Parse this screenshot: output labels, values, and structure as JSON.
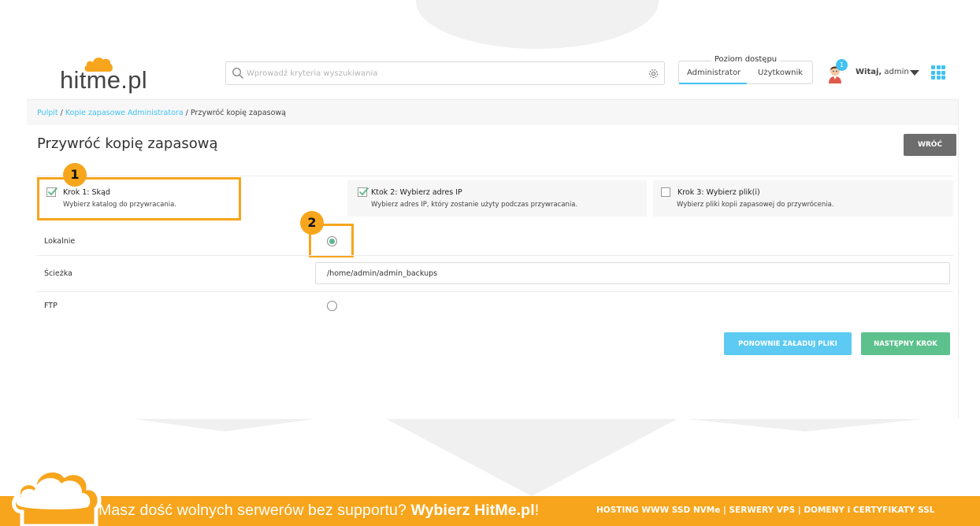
{
  "header": {
    "logo_text": "hitme.pl",
    "search_placeholder": "Wprowadź kryteria wyszukiwania",
    "access": {
      "title": "Poziom dostępu",
      "tabs": [
        "Administrator",
        "Użytkownik"
      ],
      "active": "Administrator"
    },
    "notification_count": "1",
    "greeting_bold": "Witaj,",
    "greeting_user": " admin"
  },
  "breadcrumb": {
    "items": [
      "Pulpit",
      "Kopie zapasowe Administratora",
      "Przywróć kopię zapasową"
    ],
    "separator": " / "
  },
  "page": {
    "title": "Przywróć kopię zapasową",
    "back_label": "WRÓĆ"
  },
  "steps": [
    {
      "title": "Krok 1: Skąd",
      "subtitle": "Wybierz katalog do przywracania.",
      "checked": true
    },
    {
      "title": "Ktok 2: Wybierz adres IP",
      "subtitle": "Wybierz adres IP, który zostanie użyty podczas przywracania.",
      "checked": true
    },
    {
      "title": "Krok 3: Wybierz plik(i)",
      "subtitle": "Wybierz pliki kopii zapasowej do przywrócenia.",
      "checked": false
    }
  ],
  "form": {
    "local_label": "Lokalnie",
    "local_selected": true,
    "path_label": "Ścieżka",
    "path_value": "/home/admin/admin_backups",
    "ftp_label": "FTP",
    "ftp_selected": false
  },
  "buttons": {
    "reload": "PONOWNIE ZAŁADUJ PLIKI",
    "next": "NASTĘPNY KROK"
  },
  "markers": [
    "1",
    "2"
  ],
  "footer": {
    "text_prefix": "Masz dość wolnych serwerów bez supportu? ",
    "text_brand": "Wybierz HitMe.pl",
    "text_suffix": "!",
    "right_text": "HOSTING WWW SSD NVMe | SERWERY VPS | DOMENY i CERTYFIKATY SSL"
  },
  "colors": {
    "accent_blue": "#41c2f2",
    "accent_green": "#5cc18d",
    "highlight_orange": "#f7a51c",
    "back_button": "#6d6d6d"
  }
}
